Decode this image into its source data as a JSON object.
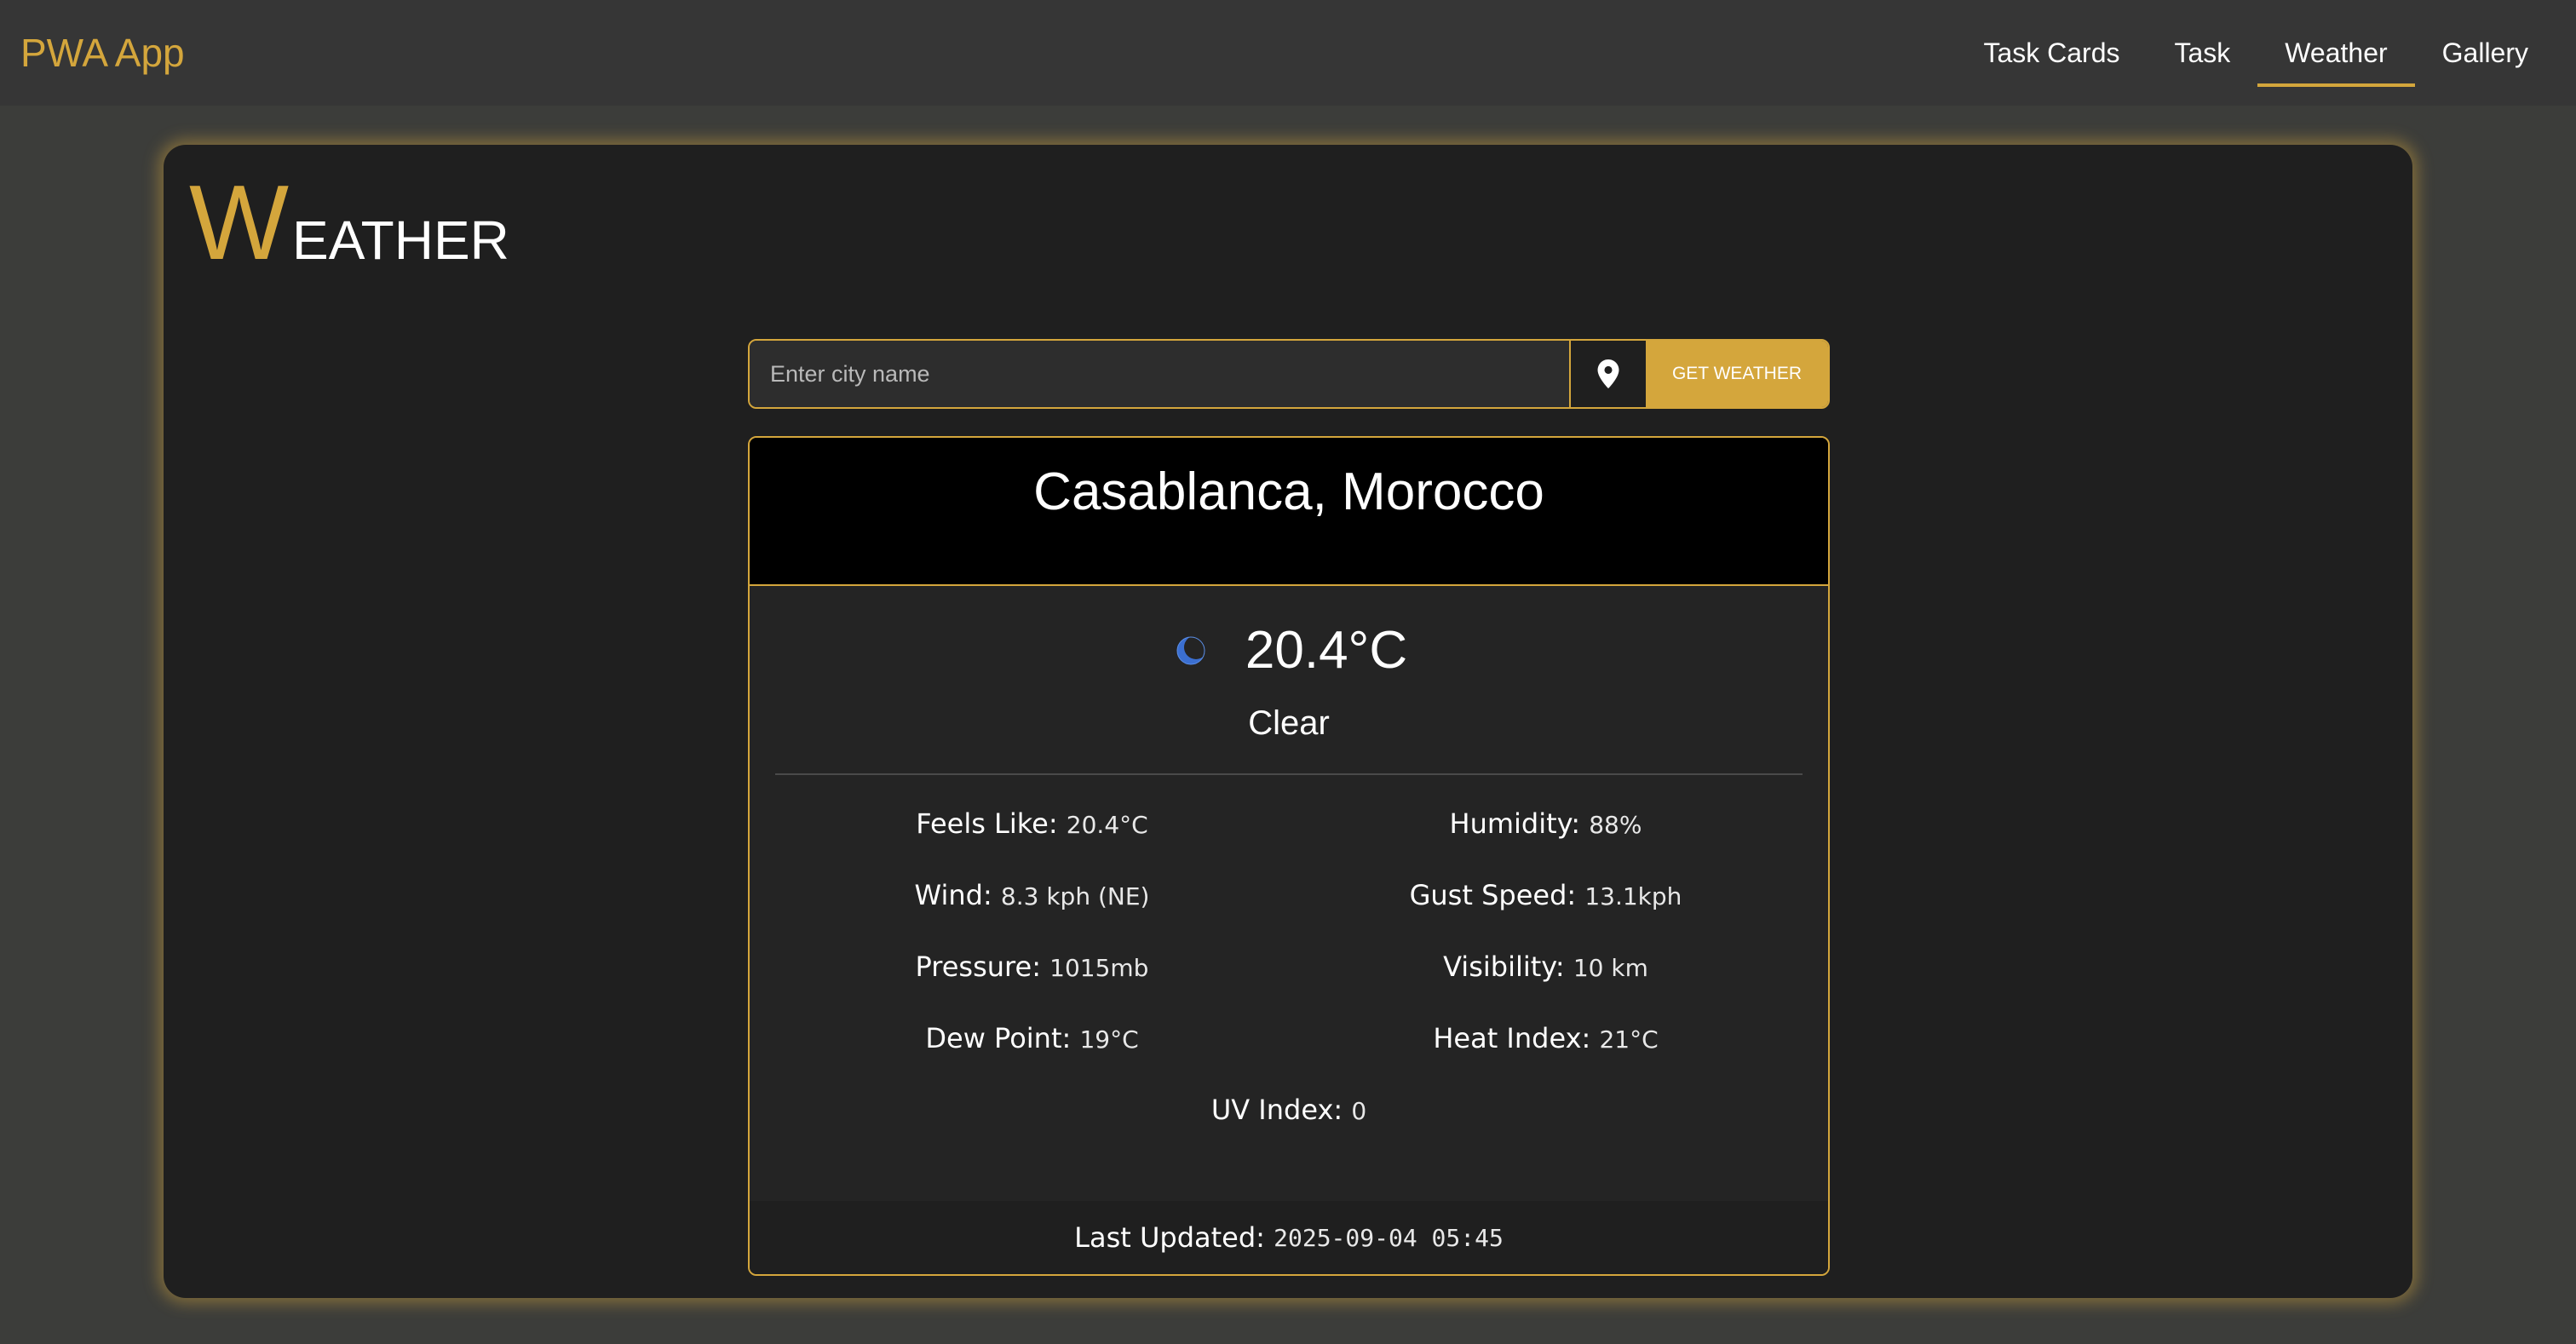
{
  "app": {
    "brand": "PWA App"
  },
  "nav": {
    "items": [
      {
        "label": "Task Cards"
      },
      {
        "label": "Task"
      },
      {
        "label": "Weather"
      },
      {
        "label": "Gallery"
      }
    ],
    "active": "Weather"
  },
  "page": {
    "title_initial": "W",
    "title_rest": "EATHER"
  },
  "search": {
    "placeholder": "Enter city name",
    "value": "",
    "locate_icon": "map-pin-icon",
    "button_label": "GET WEATHER"
  },
  "weather": {
    "city": "Casablanca,  Morocco",
    "icon": "moon-icon",
    "temperature": "20.4°C",
    "condition": "Clear",
    "details": [
      {
        "label": "Feels Like",
        "value": "20.4°C"
      },
      {
        "label": "Humidity",
        "value": "88%"
      },
      {
        "label": "Wind",
        "value": "8.3 kph (NE)"
      },
      {
        "label": "Gust Speed",
        "value": "13.1kph"
      },
      {
        "label": "Pressure",
        "value": "1015mb"
      },
      {
        "label": "Visibility",
        "value": "10 km"
      },
      {
        "label": "Dew Point",
        "value": "19°C"
      },
      {
        "label": "Heat Index",
        "value": "21°C"
      },
      {
        "label": "UV Index",
        "value": "0"
      }
    ],
    "last_updated_label": "Last Updated",
    "last_updated": "2025-09-04 05:45"
  },
  "colors": {
    "accent": "#d4a63c",
    "background": "#3c3d3a",
    "panel": "#1f1f1f"
  }
}
